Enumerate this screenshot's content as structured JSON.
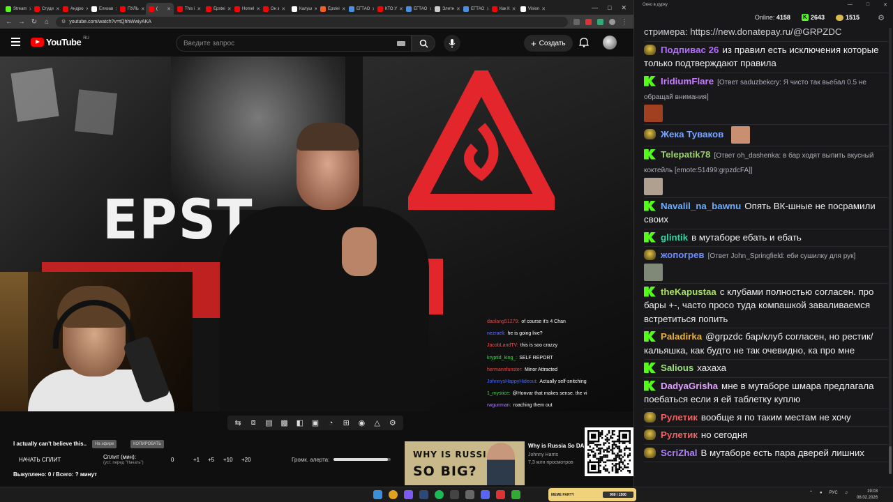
{
  "browser": {
    "tabs": [
      {
        "label": "Stream",
        "color": "#53fc18",
        "active": false
      },
      {
        "label": "Студи",
        "color": "#ff0000",
        "active": false
      },
      {
        "label": "Андрю",
        "color": "#ff0000",
        "active": false
      },
      {
        "label": "Елизав",
        "color": "#ffffff",
        "active": false
      },
      {
        "label": "ПУЛЬ",
        "color": "#ff0000",
        "active": false
      },
      {
        "label": "(",
        "color": "#ff0000",
        "active": true
      },
      {
        "label": "This i",
        "color": "#ff0000",
        "active": false
      },
      {
        "label": "Epstei",
        "color": "#ff0000",
        "active": false
      },
      {
        "label": "Homel",
        "color": "#ff0000",
        "active": false
      },
      {
        "label": "Он з",
        "color": "#ff0000",
        "active": false
      },
      {
        "label": "Калуш",
        "color": "#ffffff",
        "active": false
      },
      {
        "label": "Epstei",
        "color": "#ff5a1f",
        "active": false
      },
      {
        "label": "ЕГТАО",
        "color": "#4a90e2",
        "active": false
      },
      {
        "label": "КТО У",
        "color": "#ff0000",
        "active": false
      },
      {
        "label": "ЕГТАО",
        "color": "#4a90e2",
        "active": false
      },
      {
        "label": "Элитн",
        "color": "#cccccc",
        "active": false
      },
      {
        "label": "ЕГТАО",
        "color": "#4a90e2",
        "active": false
      },
      {
        "label": "Как К",
        "color": "#ff0000",
        "active": false
      },
      {
        "label": "Vision",
        "color": "#ffffff",
        "active": false
      }
    ],
    "url": "youtube.com/watch?v=tQhhWwiyAKA"
  },
  "youtube": {
    "logo_text": "YouTube",
    "region": "RU",
    "search_placeholder": "Введите запрос",
    "create_label": "Создать"
  },
  "video": {
    "overlay_word": "EPST",
    "chat": [
      {
        "user": "daolang51279:",
        "text": "of course it's 4 Chan",
        "color": "#e04a4a"
      },
      {
        "user": "nezraeli:",
        "text": "he is going live?",
        "color": "#6a6aff"
      },
      {
        "user": "JacobLandTV:",
        "text": "this is soo crazzy",
        "color": "#ff4d4d"
      },
      {
        "user": "kryptid_king_:",
        "text": "SELF REPORT",
        "color": "#4fd15a"
      },
      {
        "user": "hermannfunster:",
        "text": "Minor Attracted",
        "color": "#e04a4a"
      },
      {
        "user": "JohnnysHappyHideout:",
        "text": "Actually self-snitching",
        "color": "#4a6aff"
      },
      {
        "user": "1_mystice:",
        "text": "@Honvar  that makes sense. the vi",
        "color": "#4fd15a"
      },
      {
        "user": "rwgunman:",
        "text": "roaching them out",
        "color": "#b07cff"
      }
    ]
  },
  "stream_panel": {
    "title": "I actually can't believe this..",
    "btn_update": "На эфире",
    "btn_copy": "КОПИРОВАТЬ",
    "start_split": "НАЧАТЬ СПЛИТ",
    "split_label": "Сплит (мин):",
    "split_hint": "(уст. перед \"Начать\")",
    "values": [
      "0",
      "+1",
      "+5",
      "+10",
      "+20"
    ],
    "alert_label": "Громк. алерта:",
    "alert_level": 0.95,
    "bought": "Выкуплено: 0 / Всего: ? минут"
  },
  "recommendation": {
    "thumb_line1": "WHY IS RUSSIA",
    "thumb_line2": "SO BIG?",
    "title": "Why is Russia So DA",
    "channel": "Johnny Harris",
    "views": "7,3 млн просмотров"
  },
  "chat_window": {
    "title": "Окно в дурку",
    "online_label": "Online:",
    "online": "4158",
    "kick_count": "2643",
    "coin_count": "1515",
    "messages": [
      {
        "badge": "none",
        "user": "",
        "user_color": "#ffffff",
        "reply": "",
        "text": "стримера: https://new.donatepay.ru/@GRPZDC",
        "link": true
      },
      {
        "badge": "p",
        "user": "Подпивас 26",
        "user_color": "#b36bff",
        "reply": "",
        "text": "из правил есть исключения которые только подтверждают правила"
      },
      {
        "badge": "k",
        "user": "IridiumFlare",
        "user_color": "#c77dff",
        "reply": "[Ответ saduzbekcry: Я чисто так вьебал 0.5 не обращай внимания]",
        "text": "",
        "emote": "#a04020"
      },
      {
        "badge": "p",
        "user": "Жека Туваков",
        "user_color": "#7aa7ff",
        "reply": "",
        "text": "",
        "emote": "#c89070"
      },
      {
        "badge": "k",
        "user": "Telepatik78",
        "user_color": "#9ad06a",
        "reply": "[Ответ oh_dashenka: в бар ходят выпить вкусный коктейль [emote:51499:grpzdcFA]]",
        "text": "",
        "emote": "#b0a090"
      },
      {
        "badge": "k",
        "user": "Navalil_na_bawnu",
        "user_color": "#6ab0ff",
        "reply": "",
        "text": "Опять ВК-шные не посрамили своих"
      },
      {
        "badge": "k",
        "user": "glintik",
        "user_color": "#3fd0a0",
        "reply": "",
        "text": "в мутаборе ебать и ебать"
      },
      {
        "badge": "p",
        "user": "жопогрев",
        "user_color": "#6a8aff",
        "reply": "[Ответ John_Springfield: еби сушилку для рук]",
        "text": "",
        "emote": "#808878"
      },
      {
        "badge": "k",
        "user": "theKapustaa",
        "user_color": "#a8e060",
        "reply": "",
        "text": "с клубами полностью согласен. про бары +-, часто просо туда компашкой заваливаемся встретиться попить"
      },
      {
        "badge": "k",
        "user": "Paladirka",
        "user_color": "#e8b040",
        "reply": "",
        "text": "@grpzdc бар/клуб согласен, но рестик/кальяшка, как будто не так очевидно, ка про мне",
        "mention": "@grpzdc"
      },
      {
        "badge": "k",
        "user": "Salious",
        "user_color": "#9ae07a",
        "reply": "",
        "text": "хахаха"
      },
      {
        "badge": "k",
        "user": "DadyaGrisha",
        "user_color": "#e0a0ff",
        "reply": "",
        "text": "мне в мутаборе шмара предлагала поебаться если я ей таблетку куплю"
      },
      {
        "badge": "p",
        "user": "Рулетик",
        "user_color": "#f06060",
        "reply": "",
        "text": "вообще я по таким местам не хочу"
      },
      {
        "badge": "p",
        "user": "Рулетик",
        "user_color": "#f06060",
        "reply": "",
        "text": "но сегодня"
      },
      {
        "badge": "p",
        "user": "ScriZhal",
        "user_color": "#b080ff",
        "reply": "",
        "text": "В мутаборе есть пара дверей лишних"
      }
    ]
  },
  "taskbar": {
    "meme_label": "MEME PARTY",
    "meme_progress": "900 / 1500",
    "lang": "РУС",
    "time": "19:03",
    "date": "08.02.2026"
  }
}
